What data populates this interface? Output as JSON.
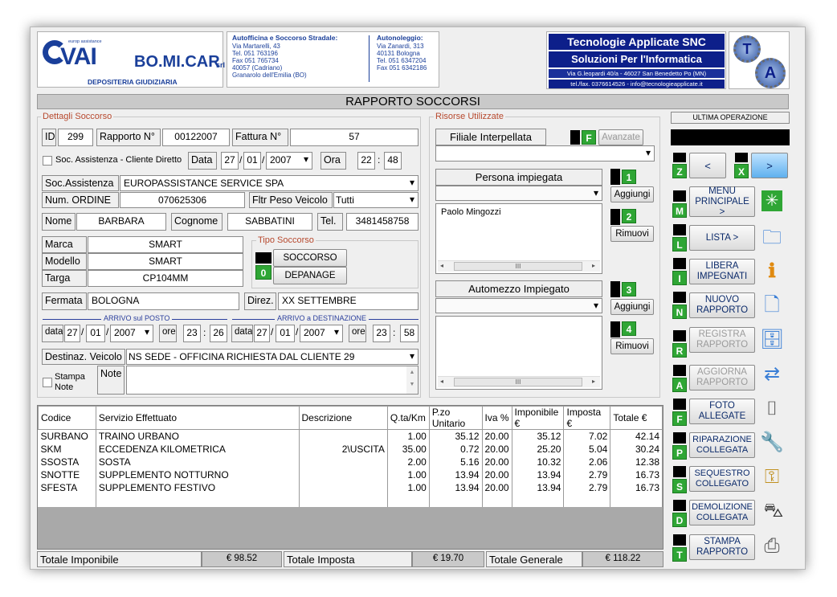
{
  "header": {
    "vai_small": "europ assistance",
    "vai_logo": "VAI",
    "bomicar": "BO.MI.CAR",
    "bomicar_srl": "srl",
    "depositeria": "DEPOSITERIA GIUDIZIARIA",
    "officina": [
      "Autofficina e Soccorso Stradale:",
      "Via Martarelli, 43",
      "Tel. 051 763196",
      "Fax 051 765734",
      "40057 (Cadriano)",
      "Granarolo dell'Emilia (BO)"
    ],
    "noleggio": [
      "Autonoleggio:",
      "Via Zanardi, 313",
      "40131 Bologna",
      "Tel. 051 6347204",
      "Fax 051 6342186"
    ],
    "company1": "Tecnologie Applicate SNC",
    "company2": "Soluzioni Per l'Informatica",
    "address": "Via G.leopardi 40/a - 46027 San Benedetto Po (MN)",
    "contact": "tel./fax. 0376614526 - info@tecnologieapplicate.it",
    "badge_top": "T",
    "badge_bottom": "A"
  },
  "title": "RAPPORTO SOCCORSI",
  "dettagli": {
    "group_title": "Dettagli Soccorso",
    "id_label": "ID",
    "id": "299",
    "rapporto_label": "Rapporto N°",
    "rapporto": "00122007",
    "fattura_label": "Fattura N°",
    "fattura": "57",
    "checkbox_label": "Soc. Assistenza - Cliente Diretto",
    "data_label": "Data",
    "day": "27",
    "month": "01",
    "year": "2007",
    "ora_label": "Ora",
    "hour": "22",
    "minute": "48",
    "soc_label": "Soc.Assistenza",
    "soc": "EUROPASSISTANCE SERVICE SPA",
    "ordine_label": "Num. ORDINE",
    "ordine": "070625306",
    "fltr_label": "Fltr Peso Veicolo",
    "fltr": "Tutti",
    "nome_label": "Nome",
    "nome": "BARBARA",
    "cognome_label": "Cognome",
    "cognome": "SABBATINI",
    "tel_label": "Tel.",
    "tel": "3481458758",
    "marca_label": "Marca",
    "marca": "SMART",
    "modello_label": "Modello",
    "modello": "SMART",
    "targa_label": "Targa",
    "targa": "CP104MM",
    "tipo_title": "Tipo Soccorso",
    "tipo_soccorso": "SOCCORSO",
    "tipo_depanage": "DEPANAGE",
    "tipo_code": "0",
    "fermata_label": "Fermata",
    "fermata": "BOLOGNA",
    "direz_label": "Direz.",
    "direz": "XX SETTEMBRE",
    "arrivo_posto": "ARRIVO sul POSTO",
    "arrivo_dest": "ARRIVO a DESTINAZIONE",
    "data_small": "data",
    "ore_small": "ore",
    "ap_day": "27",
    "ap_month": "01",
    "ap_year": "2007",
    "ap_hour": "23",
    "ap_min": "26",
    "ad_day": "27",
    "ad_month": "01",
    "ad_year": "2007",
    "ad_hour": "23",
    "ad_min": "58",
    "dest_label": "Destinaz. Veicolo",
    "dest": "NS SEDE - OFFICINA RICHIESTA DAL CLIENTE 29",
    "stampa_label": "Stampa Note",
    "note_label": "Note",
    "note": ""
  },
  "risorse": {
    "group_title": "Risorse Utilizzate",
    "filiale_label": "Filiale Interpellata",
    "f_code": "F",
    "avanzate": "Avanzate",
    "persona_label": "Persona impiegata",
    "persona_code": "1",
    "aggiungi": "Aggiungi",
    "rimuovi": "Rimuovi",
    "persona_list_code": "2",
    "persona_list": [
      "Paolo Mingozzi"
    ],
    "automezzo_label": "Automezzo Impiegato",
    "automezzo_code": "3",
    "automezzo_list_code": "4",
    "scroll_mark": "III"
  },
  "table": {
    "headers": [
      "Codice",
      "Servizio Effettuato",
      "Descrizione",
      "Q.ta/Km",
      "P.zo Unitario",
      "Iva %",
      "Imponibile €",
      "Imposta €",
      "Totale €"
    ],
    "rows": [
      [
        "SURBANO",
        "TRAINO URBANO",
        "",
        "1.00",
        "35.12",
        "20.00",
        "35.12",
        "7.02",
        "42.14"
      ],
      [
        "SKM",
        "ECCEDENZA KILOMETRICA",
        "2\\USCITA",
        "35.00",
        "0.72",
        "20.00",
        "25.20",
        "5.04",
        "30.24"
      ],
      [
        "SSOSTA",
        "SOSTA",
        "",
        "2.00",
        "5.16",
        "20.00",
        "10.32",
        "2.06",
        "12.38"
      ],
      [
        "SNOTTE",
        "SUPPLEMENTO NOTTURNO",
        "",
        "1.00",
        "13.94",
        "20.00",
        "13.94",
        "2.79",
        "16.73"
      ],
      [
        "SFESTA",
        "SUPPLEMENTO FESTIVO",
        "",
        "1.00",
        "13.94",
        "20.00",
        "13.94",
        "2.79",
        "16.73"
      ]
    ]
  },
  "totals": {
    "imponibile_label": "Totale Imponibile",
    "imponibile": "€ 98.52",
    "imposta_label": "Totale Imposta",
    "imposta": "€ 19.70",
    "generale_label": "Totale Generale",
    "generale": "€ 118.22"
  },
  "side": {
    "ultima_label": "ULTIMA OPERAZIONE",
    "ultima_value": "",
    "z_code": "Z",
    "x_code": "X",
    "prev": "<",
    "next": ">",
    "buttons": [
      {
        "code": "M",
        "label": "MENU PRINCIPALE >",
        "icon": "✳"
      },
      {
        "code": "L",
        "label": "LISTA >",
        "icon": "🗀"
      },
      {
        "code": "I",
        "label": "LIBERA IMPEGNATI",
        "icon": "ℹ"
      },
      {
        "code": "N",
        "label": "NUOVO RAPPORTO",
        "icon": "🗋"
      },
      {
        "code": "R",
        "label": "REGISTRA RAPPORTO",
        "icon": "🗄"
      },
      {
        "code": "A",
        "label": "AGGIORNA RAPPORTO",
        "icon": "⇄"
      },
      {
        "code": "F",
        "label": "FOTO ALLEGATE",
        "icon": "⌷"
      },
      {
        "code": "P",
        "label": "RIPARAZIONE COLLEGATA",
        "icon": "🔧"
      },
      {
        "code": "S",
        "label": "SEQUESTRO COLLEGATO",
        "icon": "⚿"
      },
      {
        "code": "D",
        "label": "DEMOLIZIONE COLLEGATA",
        "icon": "⛍"
      },
      {
        "code": "T",
        "label": "STAMPA RAPPORTO",
        "icon": "⎙"
      }
    ]
  },
  "colors": {
    "accent_green": "#2fa635",
    "header_blue": "#0d1f8a",
    "label_red": "#b7492e",
    "label_blue": "#2a3e9c"
  }
}
